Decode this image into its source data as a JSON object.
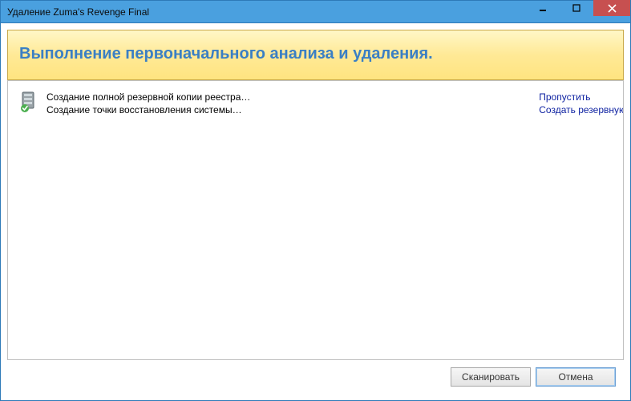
{
  "window": {
    "title": "Удаление Zuma's Revenge Final"
  },
  "header": {
    "title": "Выполнение первоначального анализа и удаления."
  },
  "status": {
    "line1": "Создание полной резервной копии реестра…",
    "line2": "Создание точки восстановления системы…"
  },
  "links": {
    "skip": "Пропустить",
    "backup": "Создать резервную"
  },
  "footer": {
    "scan": "Сканировать",
    "cancel": "Отмена"
  }
}
